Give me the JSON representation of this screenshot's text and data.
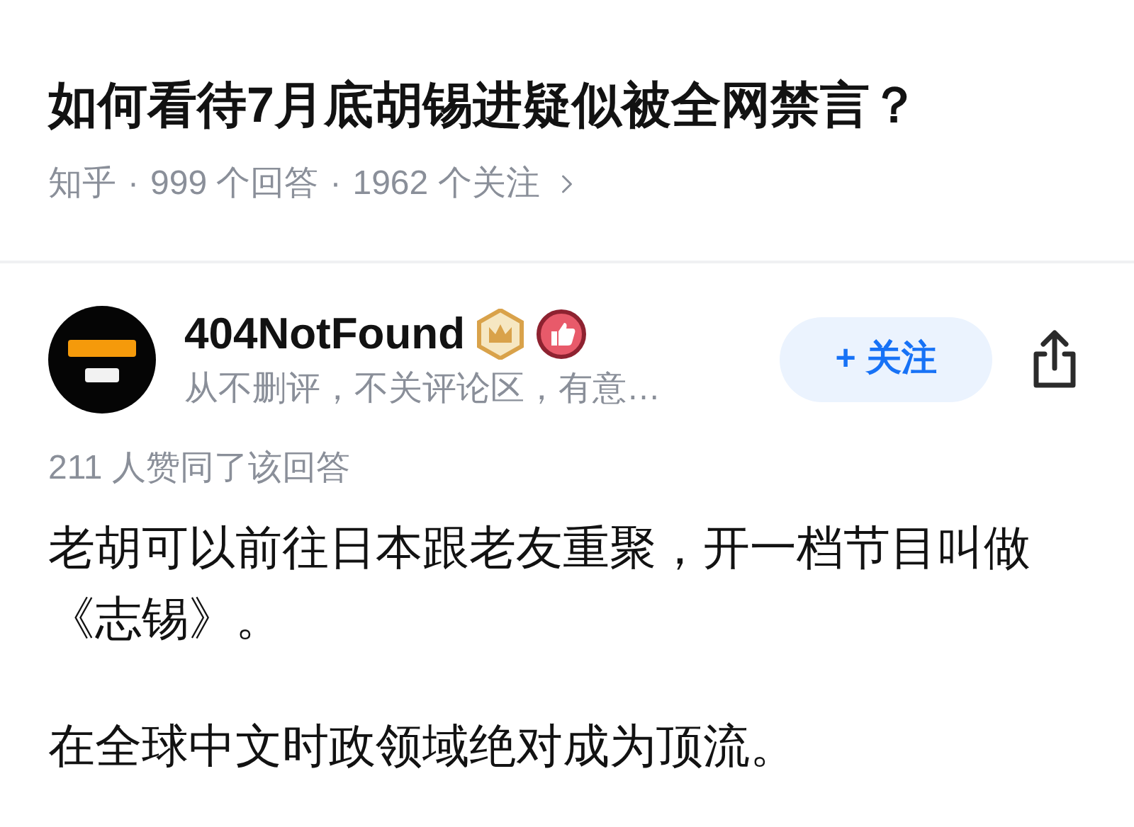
{
  "question": {
    "title": "如何看待7月底胡锡进疑似被全网禁言？",
    "meta": [
      "知乎",
      "·",
      "999 个回答",
      "·",
      "1962 个关注"
    ]
  },
  "answer": {
    "author": {
      "name": "404NotFound",
      "bio": "从不删评，不关评论区，有意…",
      "following": false
    },
    "follow_button": {
      "label": "+ 关注"
    },
    "votes": "211 人赞同了该回答",
    "paragraphs": [
      "老胡可以前往日本跟老友重聚，开一档节目叫做《志锡》。",
      "在全球中文时政领域绝对成为顶流。"
    ]
  }
}
